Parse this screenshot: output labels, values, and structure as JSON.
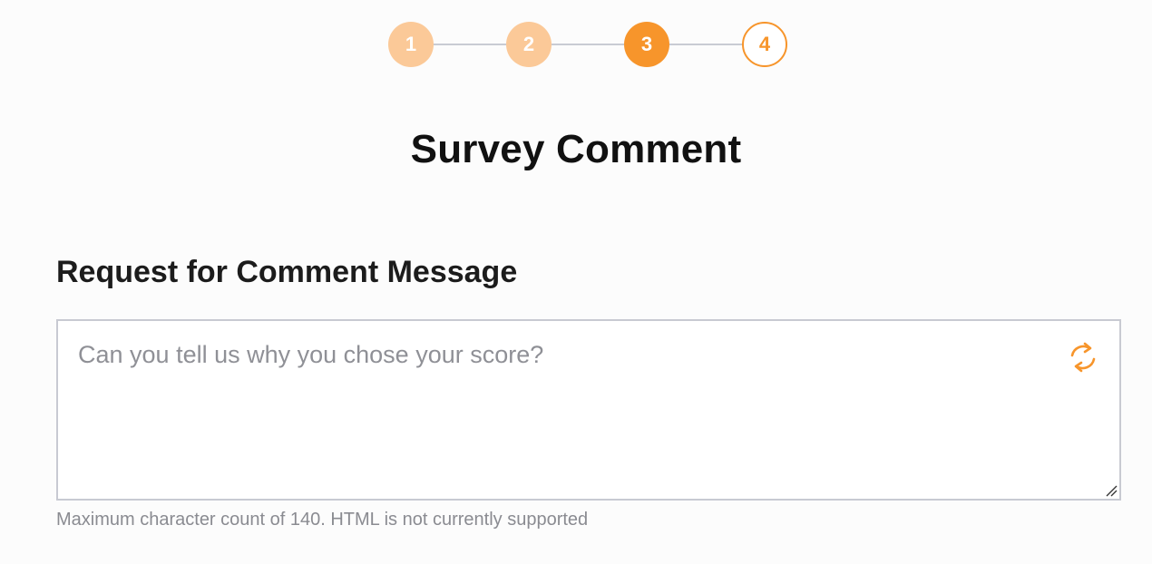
{
  "stepper": {
    "steps": [
      {
        "label": "1",
        "state": "done"
      },
      {
        "label": "2",
        "state": "done"
      },
      {
        "label": "3",
        "state": "active"
      },
      {
        "label": "4",
        "state": "pending"
      }
    ],
    "current_step": 3
  },
  "page": {
    "title": "Survey Comment"
  },
  "comment_field": {
    "label": "Request for Comment Message",
    "placeholder": "Can you tell us why you chose your score?",
    "value": "",
    "reset_icon": "refresh-icon",
    "helper": "Maximum character count of 140. HTML is not currently supported"
  },
  "colors": {
    "accent": "#f7952b",
    "accent_light": "#fbc998",
    "line": "#c9cbd3",
    "title": "#111111",
    "muted": "#8a8b91"
  }
}
